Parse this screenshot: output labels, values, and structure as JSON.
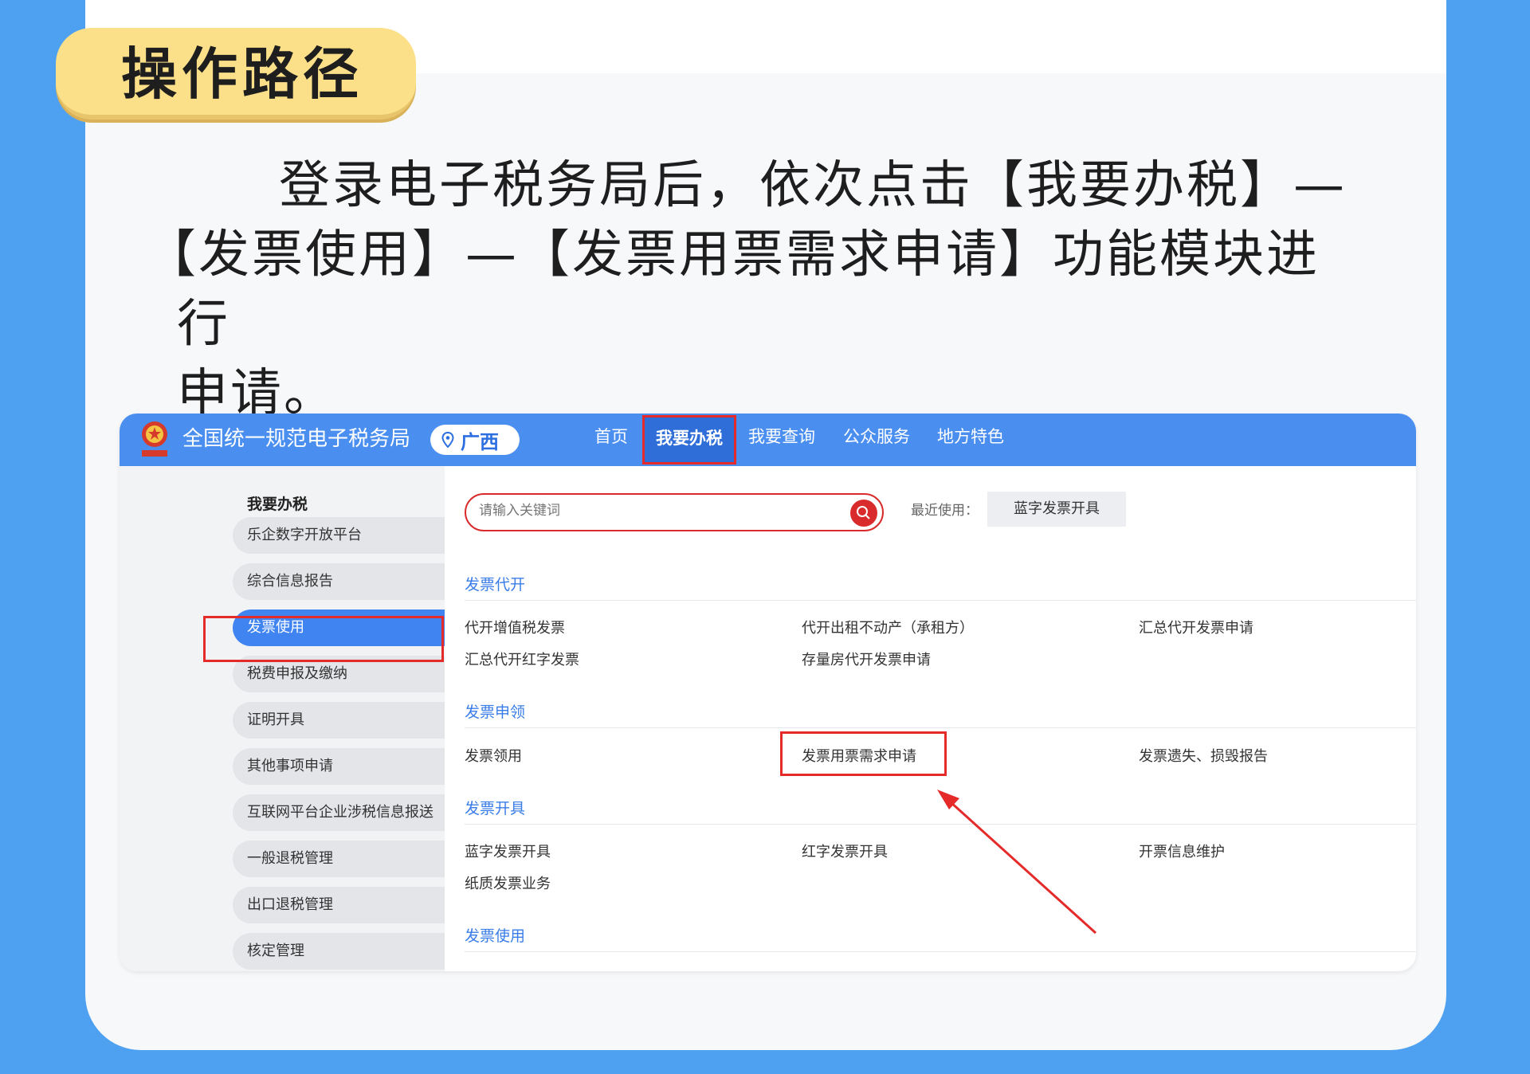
{
  "tag": {
    "title": "操作路径"
  },
  "description": {
    "line1": "登录电子税务局后，依次点击【我要办税】—",
    "line2": "【发票使用】—【发票用票需求申请】功能模块进行",
    "line3": "申请。"
  },
  "portal": {
    "site_title": "全国统一规范电子税务局",
    "region": "广西",
    "nav": [
      "首页",
      "我要办税",
      "我要查询",
      "公众服务",
      "地方特色"
    ],
    "sidebar": {
      "title": "我要办税",
      "items": [
        "乐企数字开放平台",
        "综合信息报告",
        "发票使用",
        "税费申报及缴纳",
        "证明开具",
        "其他事项申请",
        "互联网平台企业涉税信息报送",
        "一般退税管理",
        "出口退税管理",
        "核定管理"
      ]
    },
    "search": {
      "placeholder": "请输入关键词"
    },
    "recent": {
      "label": "最近使用：",
      "chip": "蓝字发票开具"
    },
    "sections": [
      {
        "title": "发票代开",
        "links": [
          "代开增值税发票",
          "代开出租不动产（承租方）",
          "汇总代开发票申请",
          "汇总代开红字发票",
          "存量房代开发票申请"
        ]
      },
      {
        "title": "发票申领",
        "links": [
          "发票领用",
          "发票用票需求申请",
          "发票遗失、损毁报告"
        ]
      },
      {
        "title": "发票开具",
        "links": [
          "蓝字发票开具",
          "红字发票开具",
          "开票信息维护",
          "纸质发票业务"
        ]
      },
      {
        "title": "发票使用",
        "links": []
      }
    ]
  },
  "colors": {
    "background": "#4ea0f0",
    "tag": "#fbe089",
    "portal_bar": "#4a8ff0",
    "highlight": "#e52a2a",
    "section": "#3a7de8"
  }
}
